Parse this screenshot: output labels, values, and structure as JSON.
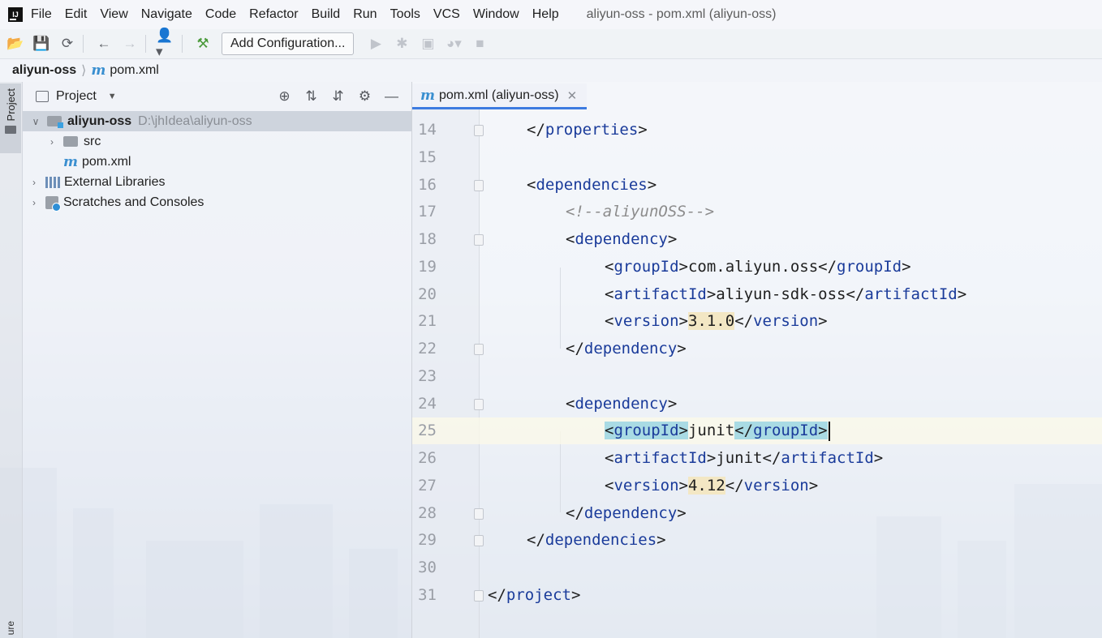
{
  "menubar": {
    "items": [
      "File",
      "Edit",
      "View",
      "Navigate",
      "Code",
      "Refactor",
      "Build",
      "Run",
      "Tools",
      "VCS",
      "Window",
      "Help"
    ],
    "window_title": "aliyun-oss - pom.xml (aliyun-oss)"
  },
  "toolbar": {
    "add_configuration_label": "Add Configuration..."
  },
  "breadcrumbs": {
    "project": "aliyun-oss",
    "file": "pom.xml"
  },
  "side_strip": {
    "project_tab": "Project",
    "bottom_label": "ure"
  },
  "project_panel": {
    "title": "Project",
    "tree": {
      "root_name": "aliyun-oss",
      "root_path": "D:\\jhIdea\\aliyun-oss",
      "src": "src",
      "pom": "pom.xml",
      "external_libraries": "External Libraries",
      "scratches": "Scratches and Consoles"
    }
  },
  "editor": {
    "tab_label": "pom.xml (aliyun-oss)",
    "lines": [
      {
        "n": "14",
        "t": "</properties>"
      },
      {
        "n": "15",
        "t": ""
      },
      {
        "n": "16",
        "t": "<dependencies>"
      },
      {
        "n": "17",
        "t": "<!--aliyunOSS-->"
      },
      {
        "n": "18",
        "t": "<dependency>"
      },
      {
        "n": "19",
        "t": "<groupId>com.aliyun.oss</groupId>"
      },
      {
        "n": "20",
        "t": "<artifactId>aliyun-sdk-oss</artifactId>"
      },
      {
        "n": "21",
        "t": "<version>3.1.0</version>"
      },
      {
        "n": "22",
        "t": "</dependency>"
      },
      {
        "n": "23",
        "t": ""
      },
      {
        "n": "24",
        "t": "<dependency>"
      },
      {
        "n": "25",
        "t": "<groupId>junit</groupId>"
      },
      {
        "n": "26",
        "t": "<artifactId>junit</artifactId>"
      },
      {
        "n": "27",
        "t": "<version>4.12</version>"
      },
      {
        "n": "28",
        "t": "</dependency>"
      },
      {
        "n": "29",
        "t": "</dependencies>"
      },
      {
        "n": "30",
        "t": ""
      },
      {
        "n": "31",
        "t": "</project>"
      }
    ]
  }
}
